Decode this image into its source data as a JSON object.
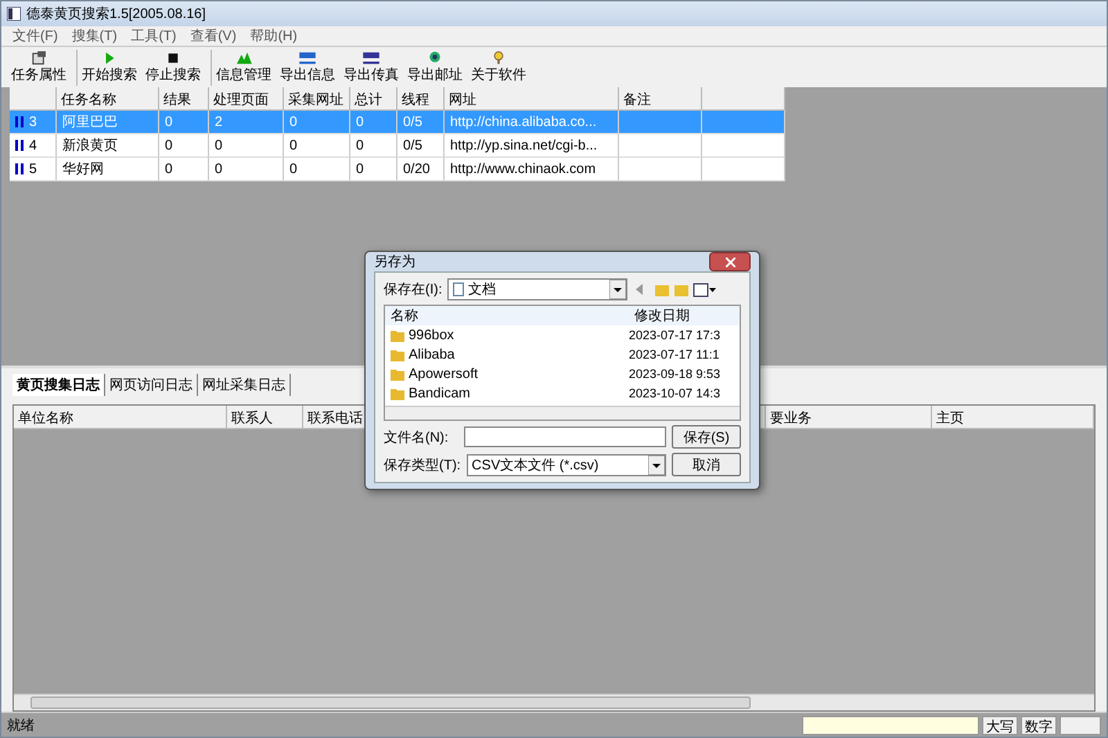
{
  "window": {
    "title": "德泰黄页搜索1.5[2005.08.16]"
  },
  "menu": [
    "文件(F)",
    "搜集(T)",
    "工具(T)",
    "查看(V)",
    "帮助(H)"
  ],
  "toolbar": [
    {
      "label": "任务属性",
      "kind": "props",
      "group_start": false
    },
    {
      "label": "开始搜索",
      "kind": "play",
      "group_start": true
    },
    {
      "label": "停止搜索",
      "kind": "stop",
      "group_start": false
    },
    {
      "label": "信息管理",
      "kind": "manage",
      "group_start": true
    },
    {
      "label": "导出信息",
      "kind": "com",
      "group_start": false
    },
    {
      "label": "导出传真",
      "kind": "fax",
      "group_start": false
    },
    {
      "label": "导出邮址",
      "kind": "mail",
      "group_start": false
    },
    {
      "label": "关于软件",
      "kind": "about",
      "group_start": false
    }
  ],
  "task_table": {
    "columns": [
      "任务名称",
      "结果",
      "处理页面",
      "采集网址",
      "总计",
      "线程",
      "网址",
      "备注"
    ],
    "rows": [
      {
        "id": "3",
        "paused": true,
        "selected": true,
        "cells": [
          "阿里巴巴",
          "0",
          "2",
          "0",
          "0",
          "0/5",
          "http://china.alibaba.co...",
          ""
        ]
      },
      {
        "id": "4",
        "paused": true,
        "selected": false,
        "cells": [
          "新浪黄页",
          "0",
          "0",
          "0",
          "0",
          "0/5",
          "http://yp.sina.net/cgi-b...",
          ""
        ]
      },
      {
        "id": "5",
        "paused": true,
        "selected": false,
        "cells": [
          "华好网",
          "0",
          "0",
          "0",
          "0",
          "0/20",
          "http://www.chinaok.com",
          ""
        ]
      }
    ]
  },
  "log_tabs": [
    {
      "label": "黄页搜集日志",
      "selected": true
    },
    {
      "label": "网页访问日志",
      "selected": false
    },
    {
      "label": "网址采集日志",
      "selected": false
    }
  ],
  "log_table": {
    "columns": [
      "单位名称",
      "联系人",
      "联系电话",
      "要业务",
      "主页"
    ]
  },
  "status_bar": {
    "message": "就绪",
    "caps": "大写",
    "num": "数字"
  },
  "dialog": {
    "title": "另存为",
    "save_in_label": "保存在(I):",
    "save_in": "文档",
    "list_columns": [
      "名称",
      "修改日期"
    ],
    "files": [
      {
        "name": "996box",
        "date": "2023-07-17 17:3"
      },
      {
        "name": "Alibaba",
        "date": "2023-07-17 11:1"
      },
      {
        "name": "Apowersoft",
        "date": "2023-09-18 9:53"
      },
      {
        "name": "Bandicam",
        "date": "2023-10-07 14:3"
      }
    ],
    "filename_label": "文件名(N):",
    "filetype_label": "保存类型(T):",
    "filetype": "CSV文本文件 (*.csv)",
    "buttons": [
      "保存(S)",
      "取消"
    ]
  }
}
